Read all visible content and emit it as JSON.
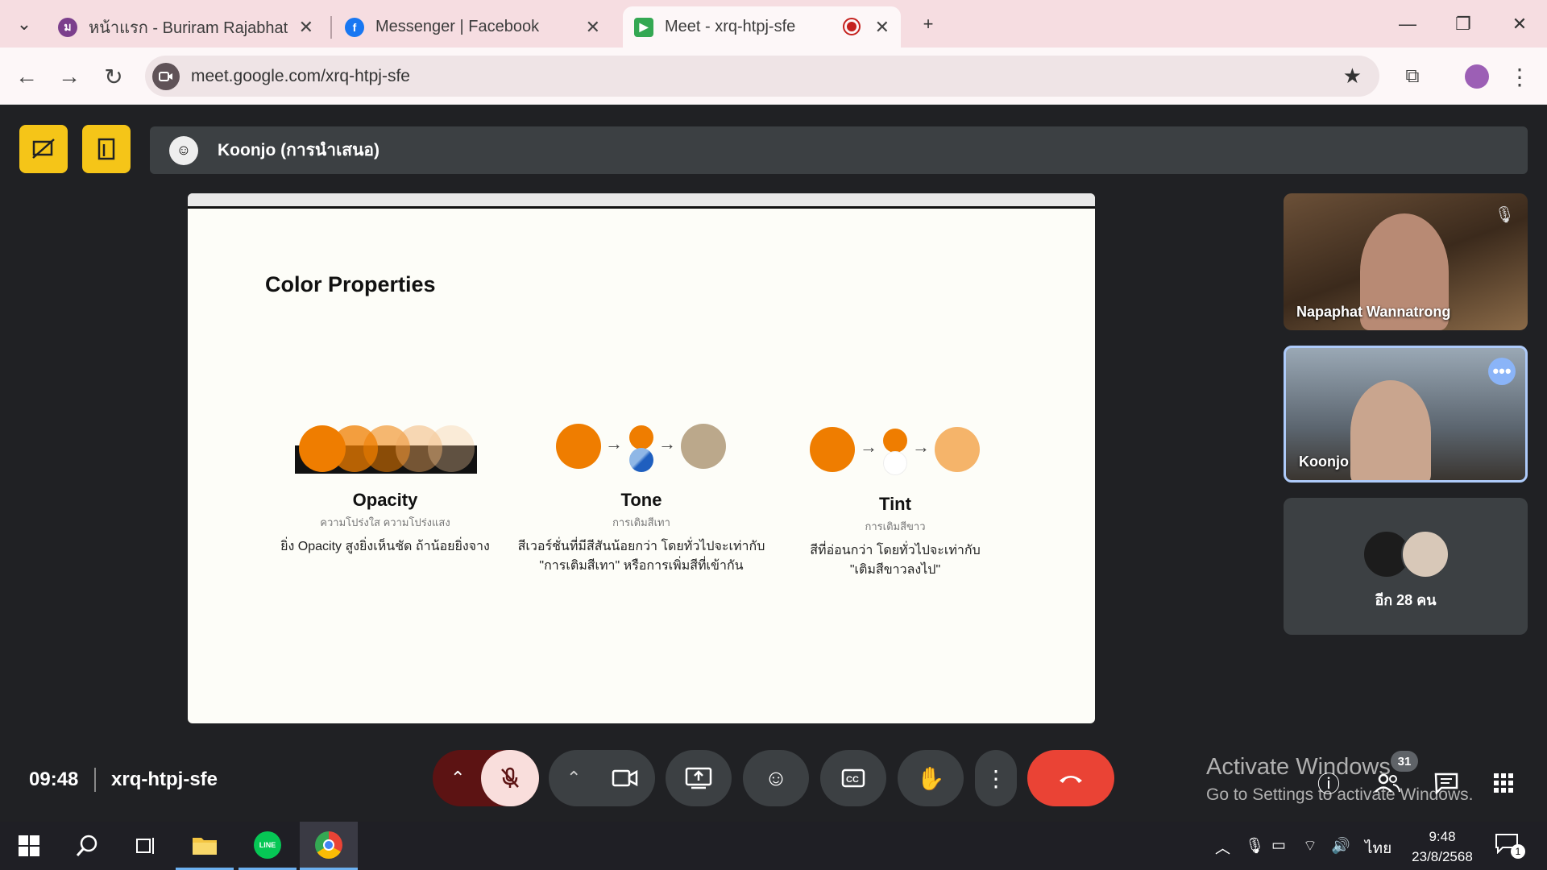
{
  "browser": {
    "tabs": [
      {
        "title": "หน้าแรก - Buriram Rajabhat Univ",
        "icon": "university-icon"
      },
      {
        "title": "Messenger | Facebook",
        "icon": "facebook-icon"
      },
      {
        "title": "Meet - xrq-htpj-sfe",
        "icon": "google-meet-icon"
      }
    ],
    "url": "meet.google.com/xrq-htpj-sfe"
  },
  "meet": {
    "presenter_label": "Koonjo (การนำเสนอ)",
    "slide": {
      "title": "Color Properties",
      "columns": [
        {
          "title": "Opacity",
          "subtitle": "ความโปร่งใส ความโปร่งแสง",
          "desc1": "ยิ่ง Opacity สูงยิ่งเห็นชัด ถ้าน้อยยิ่งจาง",
          "desc2": ""
        },
        {
          "title": "Tone",
          "subtitle": "การเติมสีเทา",
          "desc1": "สีเวอร์ชั่นที่มีสีสันน้อยกว่า โดยทั่วไปจะเท่ากับ",
          "desc2": "\"การเติมสีเทา\" หรือการเพิ่มสีที่เข้ากัน"
        },
        {
          "title": "Tint",
          "subtitle": "การเติมสีขาว",
          "desc1": "สีที่อ่อนกว่า โดยทั่วไปจะเท่ากับ",
          "desc2": "\"เติมสีขาวลงไป\""
        }
      ],
      "colors": {
        "orange": "#ef7d00",
        "tone": "#bba88b",
        "tint": "#f5b46a"
      }
    },
    "participants": [
      {
        "name": "Napaphat Wannatrong",
        "muted": true
      },
      {
        "name": "Koonjo",
        "active": true
      },
      {
        "name": "อีก 28 คน"
      }
    ],
    "time": "09:48",
    "meeting_code": "xrq-htpj-sfe",
    "participant_count": "31",
    "activate_title": "Activate Windows",
    "activate_sub": "Go to Settings to activate Windows."
  },
  "taskbar": {
    "time": "9:48",
    "date": "23/8/2568",
    "lang": "ไทย",
    "notif_count": "1"
  }
}
